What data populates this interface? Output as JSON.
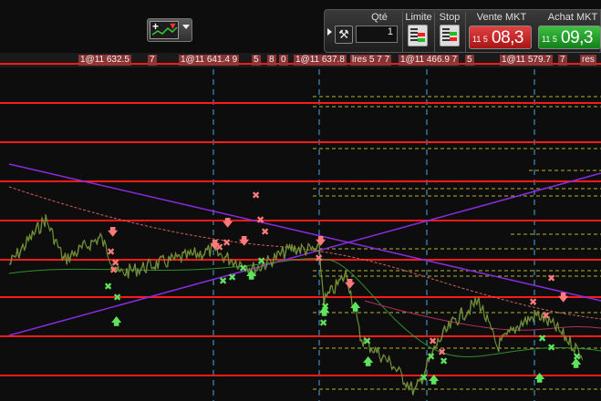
{
  "toolbar": {
    "strategy_button": {
      "plus_icon": "plus-icon",
      "down_icon": "down-arrow-icon"
    }
  },
  "order_panel": {
    "qty_label": "Qté",
    "qty_value": "1",
    "limit_label": "Limite",
    "stop_label": "Stop",
    "sell_label": "Vente MKT",
    "buy_label": "Achat MKT",
    "sell_price_small": "11 5",
    "sell_price_big": "08,3",
    "buy_price_small": "11 5",
    "buy_price_big": "09,3"
  },
  "trade_labels": [
    {
      "text": "1@11 632.5"
    },
    {
      "text": "7"
    },
    {
      "text": "1@11 641.4 9"
    },
    {
      "text": "5"
    },
    {
      "text": "8"
    },
    {
      "text": "0"
    },
    {
      "text": "1@11 637.8"
    },
    {
      "text": "lres 5 7 7"
    },
    {
      "text": "1@11 466.9 7"
    },
    {
      "text": "5"
    },
    {
      "text": "1@11 579.7"
    },
    {
      "text": "7"
    },
    {
      "text": "res"
    }
  ],
  "colors": {
    "background": "#0d0d0d",
    "level_line": "#ff1a1a",
    "trend_line": "#8a2be2",
    "buy_marker": "#5de35d",
    "sell_marker": "#ff7a7a",
    "vertical_marker": "#4aa8e8",
    "dashed_level": "#b5b530"
  }
}
